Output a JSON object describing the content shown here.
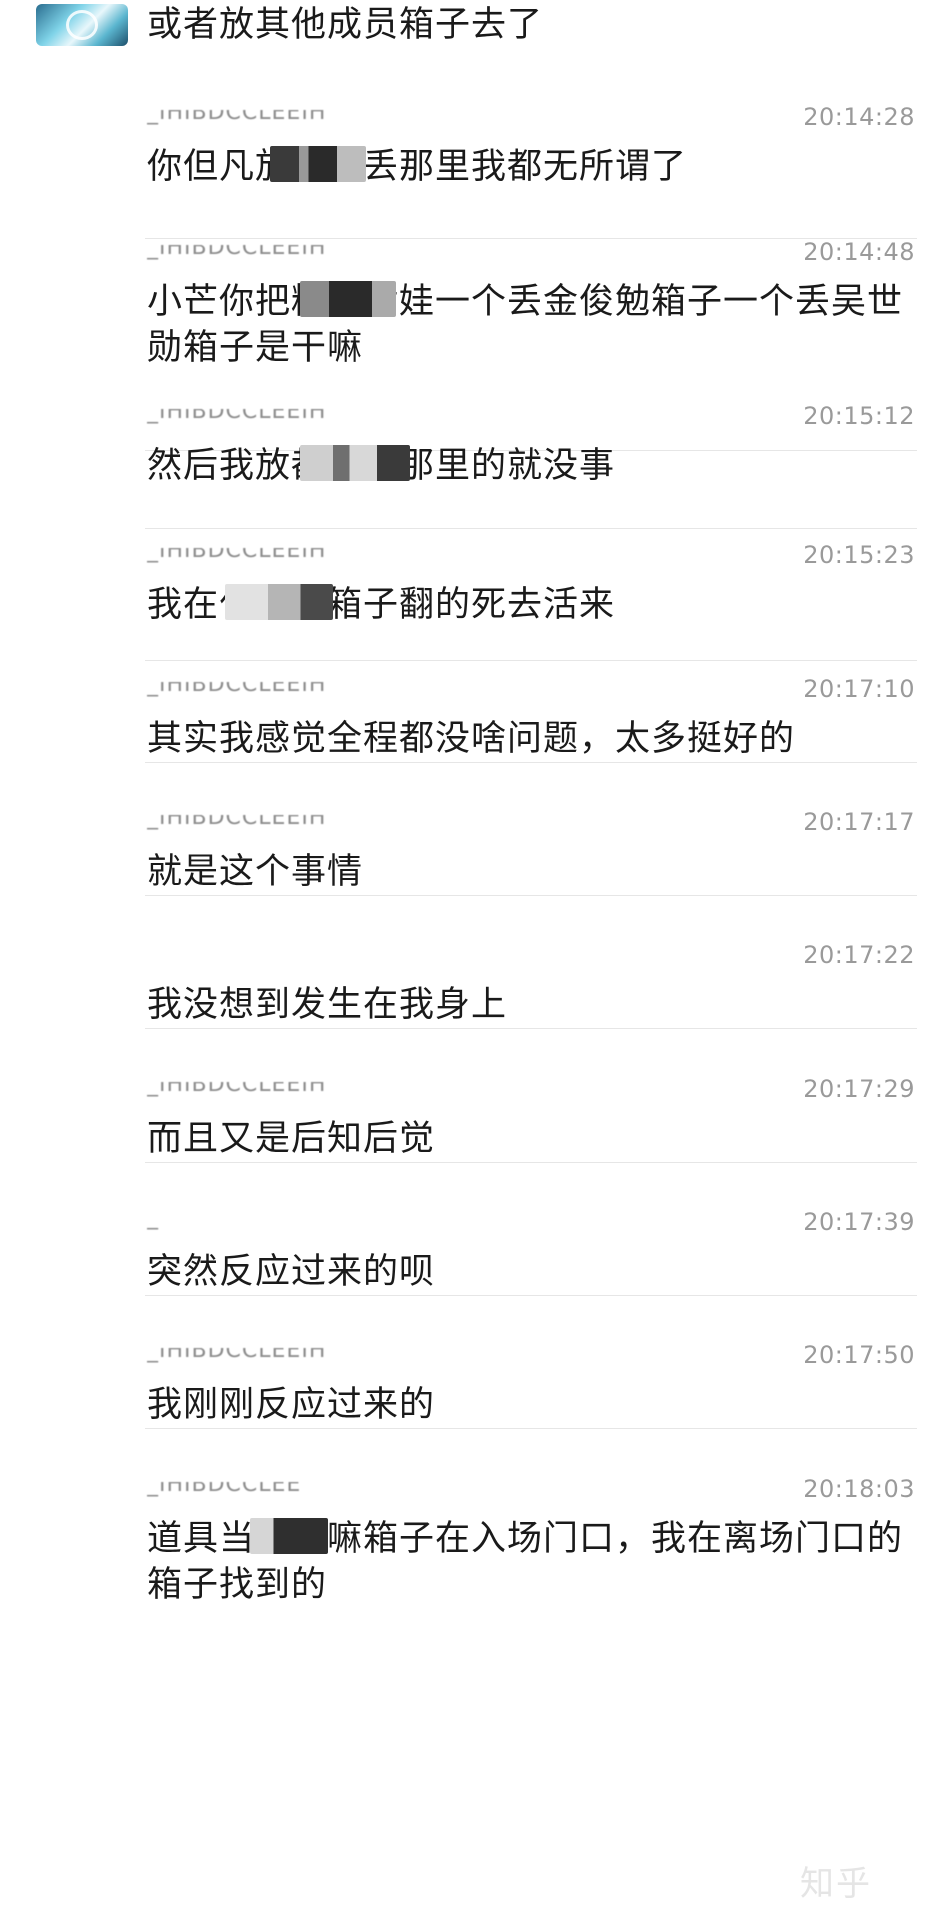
{
  "first_message": {
    "text": "或者放其他成员箱子去了"
  },
  "messages": [
    {
      "sender": "_IHIBDCCLEEIH",
      "time": "20:14:28",
      "text": "你但凡放都嘛丢那里我都无所谓了"
    },
    {
      "sender": "_IHIBDCCLEEIH",
      "time": "20:14:48",
      "text": "小芒你把糕都对娃一个丢金俊勉箱子一个丢吴世勋箱子是干嘛"
    },
    {
      "sender": "_IHIBDCCLEEIH",
      "time": "20:15:12",
      "text": "然后我放都嘛丢那里的就没事"
    },
    {
      "sender": "_IHIBDCCLEEIH",
      "time": "20:15:23",
      "text": "我在什么熊箱子翻的死去活来"
    },
    {
      "sender": "_IHIBDCCLEEIH",
      "time": "20:17:10",
      "text": "其实我感觉全程都没啥问题，太多挺好的"
    },
    {
      "sender": "_IHIBDCCLEEIH",
      "time": "20:17:17",
      "text": "就是这个事情"
    },
    {
      "sender": "",
      "time": "20:17:22",
      "text": "我没想到发生在我身上"
    },
    {
      "sender": "_IHIBDCCLEEIH",
      "time": "20:17:29",
      "text": "而且又是后知后觉"
    },
    {
      "sender": "_",
      "time": "20:17:39",
      "text": "突然反应过来的呗"
    },
    {
      "sender": "_IHIBDCCLEEIH",
      "time": "20:17:50",
      "text": "我刚刚反应过来的"
    },
    {
      "sender": "_IHIBDCCLEE",
      "time": "20:18:03",
      "text": "道具当时都嘛箱子在入场门口，我在离场门口的箱子找到的"
    }
  ],
  "watermark": "知乎"
}
